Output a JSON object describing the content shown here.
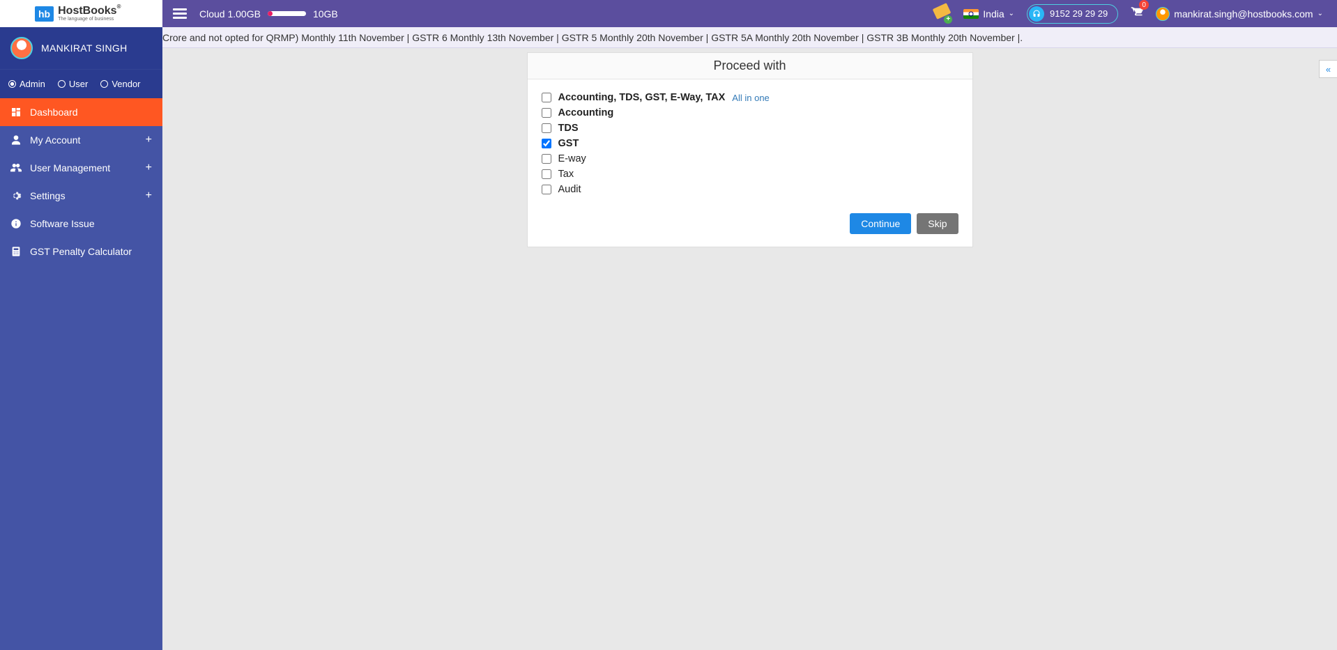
{
  "logo": {
    "badge": "hb",
    "main": "HostBooks",
    "reg": "®",
    "sub": "The language of business"
  },
  "topbar": {
    "cloud_label": "Cloud 1.00GB",
    "cloud_total": "10GB",
    "country": "India",
    "phone": "9152 29 29 29",
    "cart_count": "0",
    "user_email": "mankirat.singh@hostbooks.com"
  },
  "marquee": "Crore and not opted for QRMP) Monthly 11th November | GSTR 6 Monthly 13th November | GSTR 5 Monthly 20th November | GSTR 5A Monthly 20th November | GSTR 3B Monthly 20th November |.",
  "profile": {
    "name": "MANKIRAT SINGH"
  },
  "roles": [
    {
      "label": "Admin",
      "selected": true
    },
    {
      "label": "User",
      "selected": false
    },
    {
      "label": "Vendor",
      "selected": false
    }
  ],
  "nav": {
    "dashboard": "Dashboard",
    "my_account": "My Account",
    "user_mgmt": "User Management",
    "settings": "Settings",
    "software_issue": "Software Issue",
    "gst_penalty": "GST Penalty Calculator"
  },
  "card": {
    "title": "Proceed with",
    "options": [
      {
        "label": "Accounting, TDS, GST, E-Way, TAX",
        "suffix": "All in one",
        "bold": true,
        "checked": false
      },
      {
        "label": "Accounting",
        "bold": true,
        "checked": false
      },
      {
        "label": "TDS",
        "bold": true,
        "checked": false
      },
      {
        "label": "GST",
        "bold": true,
        "checked": true
      },
      {
        "label": "E-way",
        "bold": false,
        "checked": false
      },
      {
        "label": "Tax",
        "bold": false,
        "checked": false
      },
      {
        "label": "Audit",
        "bold": false,
        "checked": false
      }
    ],
    "continue": "Continue",
    "skip": "Skip"
  }
}
